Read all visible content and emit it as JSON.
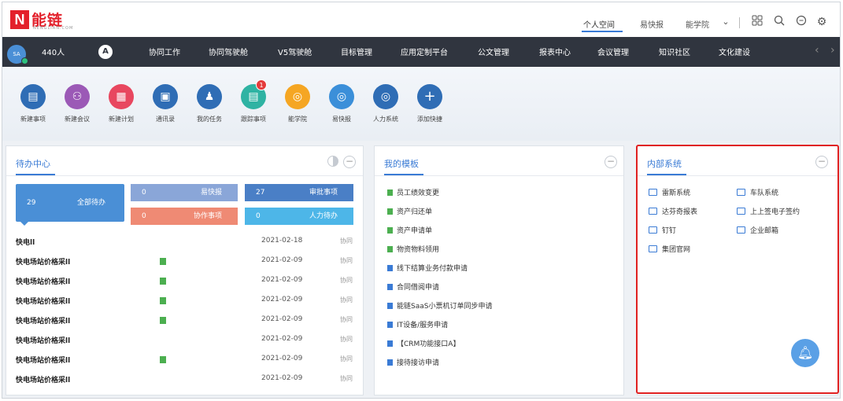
{
  "brand": {
    "logo_letter": "N",
    "name": "能链",
    "sub": "NENGLIAN.COM"
  },
  "top_links": [
    {
      "label": "个人空间",
      "active": true
    },
    {
      "label": "易快报",
      "active": false
    },
    {
      "label": "能学院",
      "active": false
    }
  ],
  "top_icons": [
    "chevron-down-icon",
    "grid-icon",
    "search-icon",
    "chat-icon",
    "gear-icon"
  ],
  "nav": {
    "user_count": "440人",
    "a_icon": "A",
    "items": [
      "协同工作",
      "协同驾驶舱",
      "V5驾驶舱",
      "目标管理",
      "应用定制平台",
      "公文管理",
      "报表中心",
      "会议管理",
      "知识社区",
      "文化建设"
    ]
  },
  "quick_actions": [
    {
      "label": "新建事项",
      "color": "#2f6db5",
      "icon": "file-icon"
    },
    {
      "label": "新建会议",
      "color": "#9b59b6",
      "icon": "people-icon"
    },
    {
      "label": "新建计划",
      "color": "#e8475f",
      "icon": "calendar-icon"
    },
    {
      "label": "通讯录",
      "color": "#2f6db5",
      "icon": "contacts-icon"
    },
    {
      "label": "我的任务",
      "color": "#2f6db5",
      "icon": "task-icon"
    },
    {
      "label": "跟踪事项",
      "color": "#2fb3a3",
      "icon": "track-icon",
      "badge": "1"
    },
    {
      "label": "能学院",
      "color": "#f5a623",
      "icon": "school-icon"
    },
    {
      "label": "易快报",
      "color": "#3b8fd9",
      "icon": "report-icon"
    },
    {
      "label": "人力系统",
      "color": "#2f6db5",
      "icon": "hr-icon"
    },
    {
      "label": "添加快捷",
      "color": "#2f6db5",
      "icon": "plus-icon"
    }
  ],
  "todo": {
    "title": "待办中心",
    "tiles": [
      {
        "count": "29",
        "label": "全部待办",
        "color": "#4a8fd6"
      },
      {
        "count": "0",
        "label": "易快报",
        "color": "#8aa6d8"
      },
      {
        "count": "27",
        "label": "审批事项",
        "color": "#4a7fc6"
      },
      {
        "count": "0",
        "label": "协作事项",
        "color": "#ef8a74"
      },
      {
        "count": "0",
        "label": "人力待办",
        "color": "#4db6e8"
      }
    ],
    "rows": [
      {
        "title": "快电ll",
        "date": "2021-02-18",
        "cat": "协同",
        "mark": false
      },
      {
        "title": "快电场站价格采ll",
        "date": "2021-02-09",
        "cat": "协同",
        "mark": true
      },
      {
        "title": "快电场站价格采ll",
        "date": "2021-02-09",
        "cat": "协同",
        "mark": true
      },
      {
        "title": "快电场站价格采ll",
        "date": "2021-02-09",
        "cat": "协同",
        "mark": true
      },
      {
        "title": "快电场站价格采ll",
        "date": "2021-02-09",
        "cat": "协同",
        "mark": true
      },
      {
        "title": "快电场站价格采ll",
        "date": "2021-02-09",
        "cat": "协同",
        "mark": false
      },
      {
        "title": "快电场站价格采ll",
        "date": "2021-02-09",
        "cat": "协同",
        "mark": true
      },
      {
        "title": "快电场站价格采ll",
        "date": "2021-02-09",
        "cat": "协同",
        "mark": false
      }
    ]
  },
  "templates": {
    "title": "我的模板",
    "items": [
      {
        "label": "员工绩效变更",
        "color": "#4caf50"
      },
      {
        "label": "资产归还单",
        "color": "#4caf50"
      },
      {
        "label": "资产申请单",
        "color": "#4caf50"
      },
      {
        "label": "物资物料领用",
        "color": "#4caf50"
      },
      {
        "label": "线下结算业务付款申请",
        "color": "#3a7bd5"
      },
      {
        "label": "合同借阅申请",
        "color": "#3a7bd5"
      },
      {
        "label": "能链SaaS小票机订单同步申请",
        "color": "#3a7bd5"
      },
      {
        "label": "IT设备/服务申请",
        "color": "#3a7bd5"
      },
      {
        "label": "【CRM功能接口A】",
        "color": "#3a7bd5"
      },
      {
        "label": "接待接访申请",
        "color": "#3a7bd5"
      }
    ]
  },
  "systems": {
    "title": "内部系统",
    "items": [
      "雷斯系统",
      "车队系统",
      "达芬奇报表",
      "上上签电子签约",
      "钉钉",
      "企业邮箱",
      "集团官网"
    ]
  }
}
